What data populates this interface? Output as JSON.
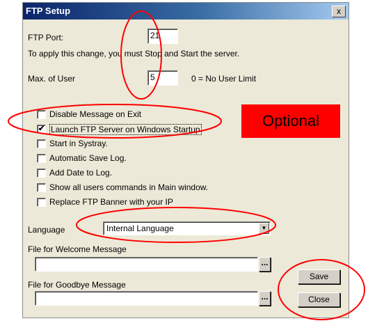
{
  "dialog": {
    "title": "FTP Setup",
    "close_label": "x"
  },
  "ftp_port": {
    "label": "FTP Port:",
    "value": "21"
  },
  "apply_note": "To apply this change, you must Stop and Start the server.",
  "max_user": {
    "label": "Max. of User",
    "value": "5",
    "hint": "0 = No User Limit"
  },
  "checkboxes": [
    {
      "label": "Disable Message on Exit",
      "checked": false
    },
    {
      "label": "Launch FTP Server on Windows Startup",
      "checked": true,
      "mark": "✔"
    },
    {
      "label": "Start in Systray.",
      "checked": false
    },
    {
      "label": "Automatic Save Log.",
      "checked": false
    },
    {
      "label": "Add Date to Log.",
      "checked": false
    },
    {
      "label": "Show all users commands in Main window.",
      "checked": false
    },
    {
      "label": "Replace FTP Banner with your IP",
      "checked": false
    }
  ],
  "language": {
    "label": "Language",
    "selected": "Internal Language",
    "arrow": "▼"
  },
  "welcome": {
    "label": "File for Welcome Message",
    "value": "",
    "browse": "..."
  },
  "goodbye": {
    "label": "File for Goodbye Message",
    "value": "",
    "browse": "..."
  },
  "buttons": {
    "save": "Save",
    "close": "Close"
  },
  "annotation": {
    "optional": "Optional",
    "color": "#ff0000"
  }
}
